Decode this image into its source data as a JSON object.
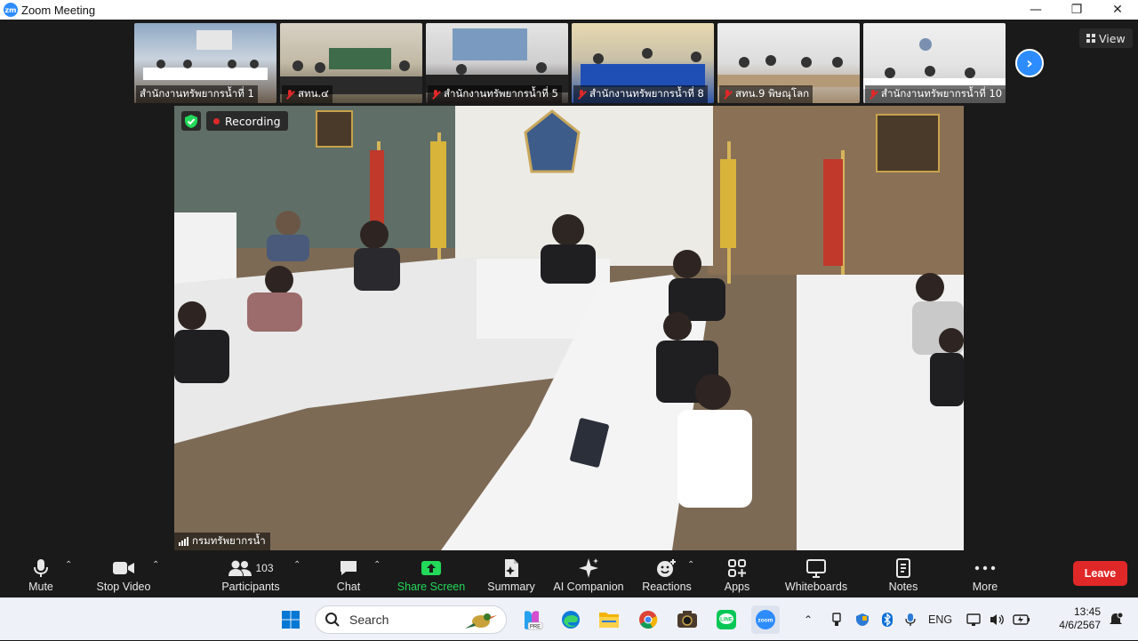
{
  "window": {
    "title": "Zoom Meeting",
    "controls": {
      "minimize": "—",
      "restore": "❐",
      "close": "✕"
    }
  },
  "thumbnails": [
    {
      "label": "สำนักงานทรัพยากรน้ำที่ 1",
      "muted": false
    },
    {
      "label": "สทน.๔",
      "muted": true
    },
    {
      "label": "สำนักงานทรัพยากรน้ำที่ 5",
      "muted": true
    },
    {
      "label": "สำนักงานทรัพยากรน้ำที่ 8",
      "muted": true
    },
    {
      "label": "สทน.9 พิษณุโลก",
      "muted": true
    },
    {
      "label": "สำนักงานทรัพยากรน้ำที่ 10",
      "muted": true
    }
  ],
  "view_label": "View",
  "recording_label": "Recording",
  "main_speaker": "กรมทรัพยากรน้ำ",
  "toolbar": {
    "mute": "Mute",
    "stop_video": "Stop Video",
    "participants": "Participants",
    "participants_count": "103",
    "chat": "Chat",
    "share_screen": "Share Screen",
    "summary": "Summary",
    "ai_companion": "AI Companion",
    "reactions": "Reactions",
    "apps": "Apps",
    "whiteboards": "Whiteboards",
    "notes": "Notes",
    "more": "More",
    "leave": "Leave"
  },
  "taskbar": {
    "search_placeholder": "Search",
    "language": "ENG",
    "time": "13:45",
    "date": "4/6/2567"
  },
  "colors": {
    "accent": "#2d8cff",
    "leave": "#e02828",
    "share": "#23d959"
  }
}
